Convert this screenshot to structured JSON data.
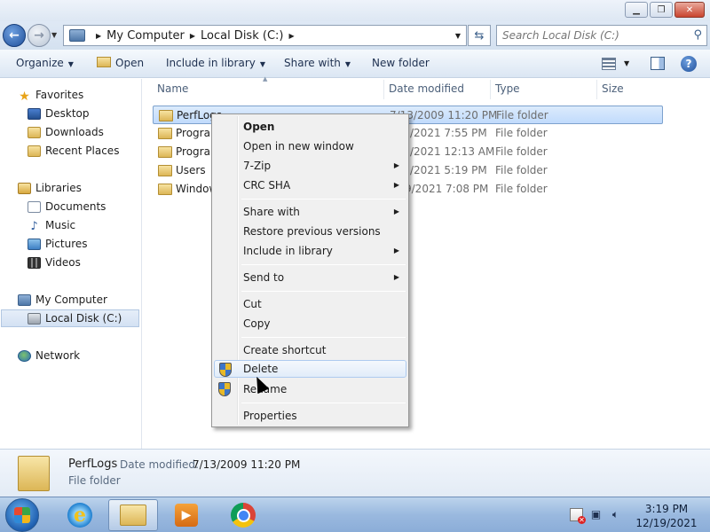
{
  "address": {
    "crumbs": [
      "My Computer",
      "Local Disk (C:)"
    ],
    "search_placeholder": "Search Local Disk (C:)"
  },
  "toolbar": {
    "organize": "Organize",
    "open": "Open",
    "include_in_library": "Include in library",
    "share_with": "Share with",
    "new_folder": "New folder"
  },
  "nav": {
    "favorites": "Favorites",
    "desktop": "Desktop",
    "downloads": "Downloads",
    "recent_places": "Recent Places",
    "libraries": "Libraries",
    "documents": "Documents",
    "music": "Music",
    "pictures": "Pictures",
    "videos": "Videos",
    "my_computer": "My Computer",
    "local_disk": "Local Disk (C:)",
    "network": "Network"
  },
  "columns": {
    "name": "Name",
    "date_modified": "Date modified",
    "type": "Type",
    "size": "Size"
  },
  "files": [
    {
      "name": "PerfLogs",
      "date": "7/13/2009 11:20 PM",
      "type": "File folder"
    },
    {
      "name": "Program",
      "date": "/2021 7:55 PM",
      "type": "File folder"
    },
    {
      "name": "Program",
      "date": "/2021 12:13 AM",
      "type": "File folder"
    },
    {
      "name": "Users",
      "date": "/2021 5:19 PM",
      "type": "File folder"
    },
    {
      "name": "Window",
      "date": "9/2021 7:08 PM",
      "type": "File folder"
    }
  ],
  "context_menu": {
    "open": "Open",
    "open_new_window": "Open in new window",
    "seven_zip": "7-Zip",
    "crc_sha": "CRC SHA",
    "share_with": "Share with",
    "restore_previous": "Restore previous versions",
    "include_in_library": "Include in library",
    "send_to": "Send to",
    "cut": "Cut",
    "copy": "Copy",
    "create_shortcut": "Create shortcut",
    "delete": "Delete",
    "rename": "Rename",
    "properties": "Properties"
  },
  "details": {
    "name": "PerfLogs",
    "date_label": "Date modified:",
    "date_value": "7/13/2009 11:20 PM",
    "type": "File folder"
  },
  "taskbar": {
    "time": "3:19 PM",
    "date": "12/19/2021"
  }
}
